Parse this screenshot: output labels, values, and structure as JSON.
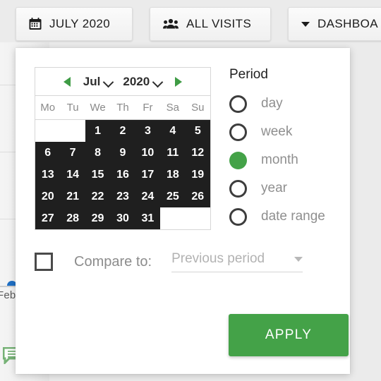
{
  "toolbar": {
    "buttons": [
      {
        "label": "JULY 2020",
        "icon": "calendar-icon"
      },
      {
        "label": "ALL VISITS",
        "icon": "people-group-icon"
      },
      {
        "label": "DASHBOA",
        "icon": "caret-down-icon"
      }
    ]
  },
  "background": {
    "axis_label": "Feb",
    "note_icon": "note-bubble-icon",
    "marker_icon": "blue-point-marker"
  },
  "calendar": {
    "prev_icon": "caret-left-icon",
    "next_icon": "caret-right-icon",
    "month": "Jul",
    "year": "2020",
    "month_caret_icon": "chevron-down-icon",
    "year_caret_icon": "chevron-down-icon",
    "weekdays": [
      "Mo",
      "Tu",
      "We",
      "Th",
      "Fr",
      "Sa",
      "Su"
    ],
    "leading_blanks": 2,
    "days": [
      1,
      2,
      3,
      4,
      5,
      6,
      7,
      8,
      9,
      10,
      11,
      12,
      13,
      14,
      15,
      16,
      17,
      18,
      19,
      20,
      21,
      22,
      23,
      24,
      25,
      26,
      27,
      28,
      29,
      30,
      31
    ],
    "selected_days": [
      1,
      2,
      3,
      4,
      5,
      6,
      7,
      8,
      9,
      10,
      11,
      12,
      13,
      14,
      15,
      16,
      17,
      18,
      19,
      20,
      21,
      22,
      23,
      24,
      25,
      26,
      27,
      28,
      29,
      30,
      31
    ],
    "trailing_blanks": 2
  },
  "period": {
    "title": "Period",
    "options": [
      {
        "label": "day",
        "selected": false
      },
      {
        "label": "week",
        "selected": false
      },
      {
        "label": "month",
        "selected": true
      },
      {
        "label": "year",
        "selected": false
      },
      {
        "label": "date range",
        "selected": false
      }
    ]
  },
  "compare": {
    "label": "Compare to:",
    "checked": false,
    "select_value": "Previous period",
    "select_caret_icon": "caret-down-icon"
  },
  "apply": {
    "label": "APPLY"
  },
  "colors": {
    "accent_green": "#44a248",
    "arrow_green": "#3f9c45",
    "selected_day_bg": "#1f1f1f",
    "muted_text": "#8f8f8f"
  }
}
